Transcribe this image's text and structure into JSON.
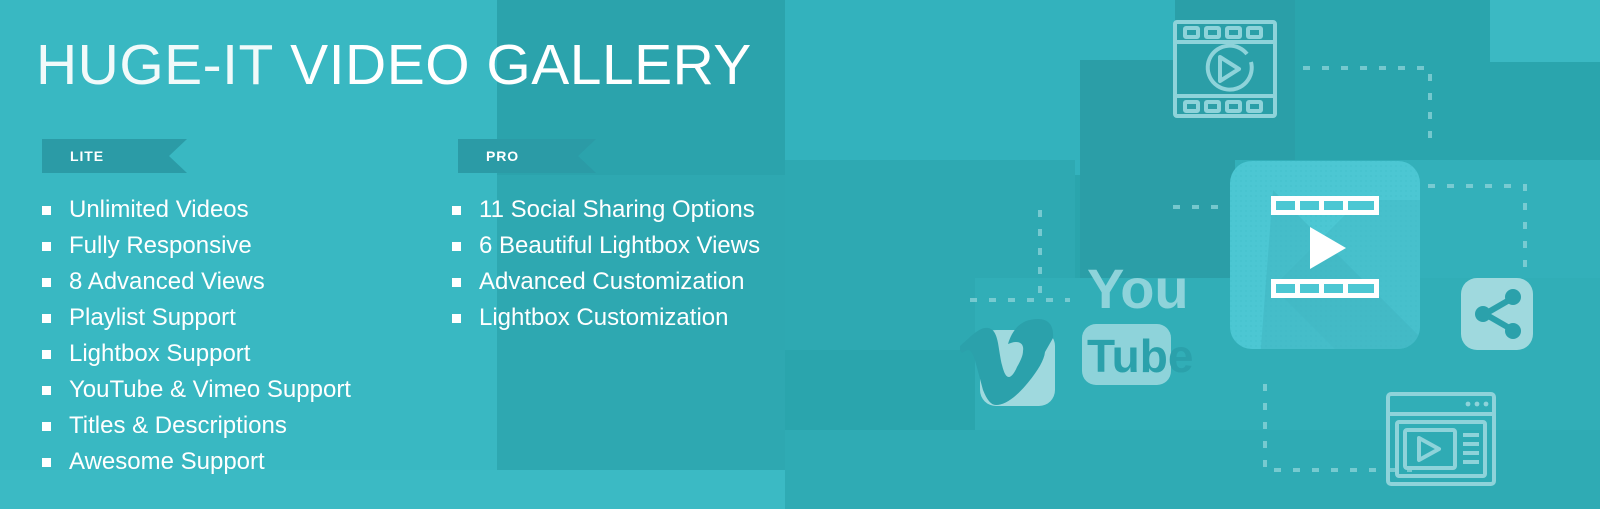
{
  "banner": {
    "title": {
      "thin": "HUGE-IT",
      "bold": "VIDEO GALLERY"
    },
    "colors": {
      "background_light": "#3bb9c3",
      "background_dark": "#2aa5ad",
      "ribbon": "#2b9ba6",
      "text": "#ffffff",
      "card_light": "#4cc6d2",
      "icon_pale": "#9fd9de"
    }
  },
  "plans": [
    {
      "ribbon_label": "LITE",
      "features": [
        "Unlimited Videos",
        "Fully Responsive",
        "8 Advanced Views",
        "Playlist Support",
        "Lightbox Support",
        "YouTube & Vimeo Support",
        "Titles & Descriptions",
        "Awesome Support"
      ]
    },
    {
      "ribbon_label": "PRO",
      "features": [
        "11 Social Sharing Options",
        "6 Beautiful Lightbox Views",
        "Advanced Customization",
        "Lightbox Customization"
      ]
    }
  ],
  "artwork": {
    "film_strip_icon": "film-strip-play-icon",
    "video_card_icon": "video-player-card-icon",
    "youtube_logo": {
      "top": "You",
      "bottom": "Tube"
    },
    "vimeo_logo": "v",
    "share_icon": "share-nodes-icon",
    "browser_icon": "browser-video-window-icon"
  }
}
